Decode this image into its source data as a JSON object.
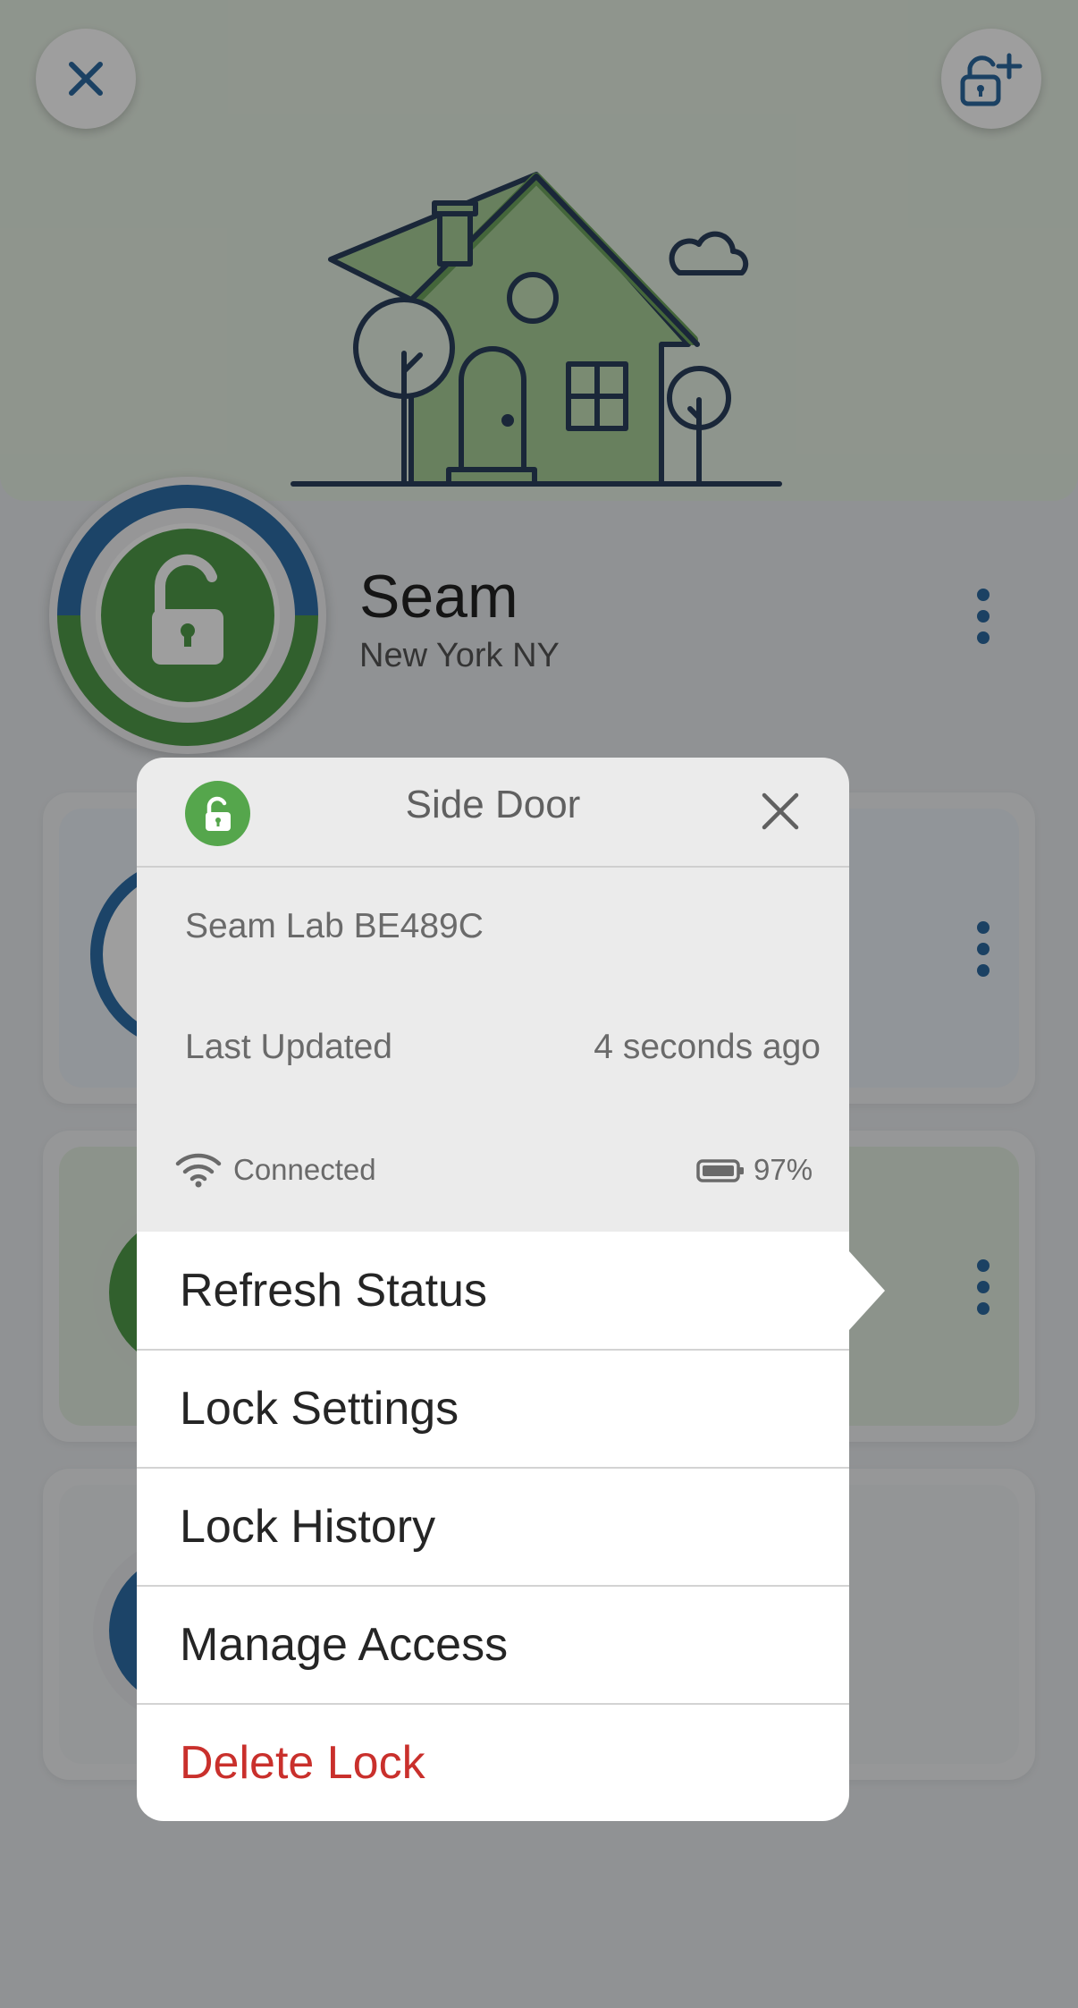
{
  "header": {
    "close_icon": "close-icon",
    "add_lock_icon": "lock-add-icon"
  },
  "location": {
    "name": "Seam",
    "address": "New York NY"
  },
  "popup": {
    "title": "Side Door",
    "device_model": "Seam Lab BE489C",
    "last_updated_label": "Last Updated",
    "last_updated_value": "4 seconds ago",
    "connection_status": "Connected",
    "battery_level": "97%",
    "menu": [
      {
        "label": "Refresh Status"
      },
      {
        "label": "Lock Settings"
      },
      {
        "label": "Lock History"
      },
      {
        "label": "Manage Access"
      },
      {
        "label": "Delete Lock"
      }
    ]
  },
  "colors": {
    "accent_blue": "#2c6aa0",
    "unlocked_green": "#55a64c",
    "danger_red": "#c9302c"
  }
}
